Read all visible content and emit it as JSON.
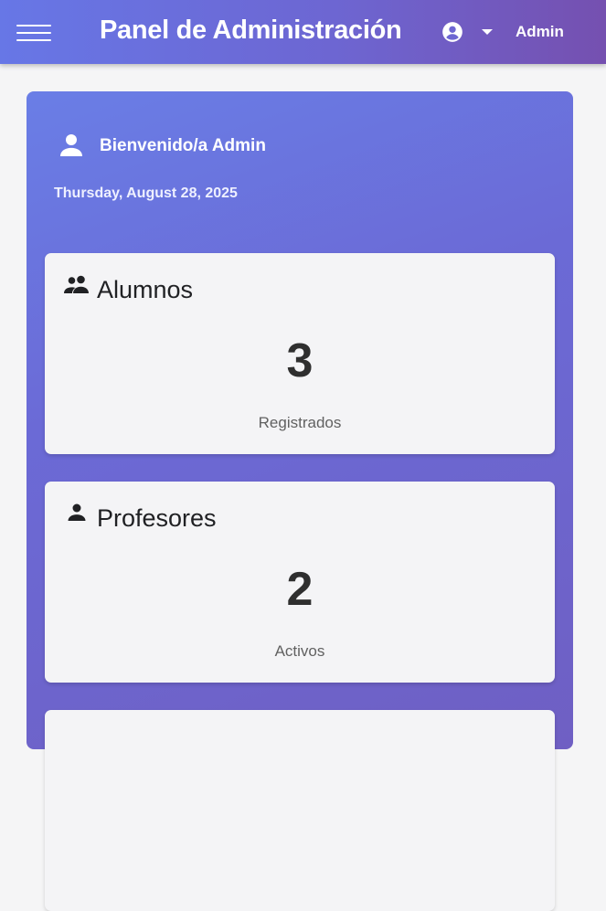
{
  "header": {
    "title": "Panel de Administración",
    "user_label": "Admin",
    "menu_icon": "menu-icon",
    "account_icon": "account-circle-icon",
    "dropdown_icon": "caret-down-icon"
  },
  "welcome": {
    "greeting": "Bienvenido/a Admin",
    "date": "Thursday, August 28, 2025",
    "icon": "person-icon"
  },
  "stats": [
    {
      "title": "Alumnos",
      "value": "3",
      "caption": "Registrados",
      "icon": "people-icon"
    },
    {
      "title": "Profesores",
      "value": "2",
      "caption": "Activos",
      "icon": "person-icon"
    }
  ],
  "colors": {
    "header_gradient_start": "#6777e6",
    "header_gradient_end": "#7550b0",
    "card_gradient_start": "#6a7ee6",
    "card_gradient_end": "#6f5fc3",
    "stat_card_bg": "#f4f4f6"
  }
}
